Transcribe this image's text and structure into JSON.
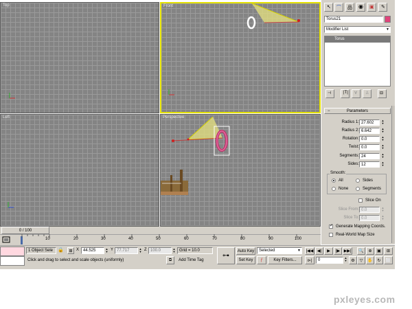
{
  "viewports": {
    "top": "Top",
    "front": "Front",
    "left": "Left",
    "perspective": "Perspective"
  },
  "command_panel": {
    "object_name": "Torus21",
    "modifier_list": "Modifier List",
    "stack_item": "Torus",
    "rollout_title": "Parameters",
    "params": [
      {
        "label": "Radius 1:",
        "value": "27.602"
      },
      {
        "label": "Radius 2:",
        "value": "6.642"
      },
      {
        "label": "Rotation:",
        "value": "0.0"
      },
      {
        "label": "Twist:",
        "value": "0.0"
      },
      {
        "label": "Segments:",
        "value": "24"
      },
      {
        "label": "Sides:",
        "value": "12"
      }
    ],
    "smooth_label": "Smooth:",
    "smooth_options": [
      "All",
      "Sides",
      "None",
      "Segments"
    ],
    "smooth_selected": "All",
    "slice_on": "Slice On",
    "slice_from_label": "Slice From:",
    "slice_from_value": "0.0",
    "slice_to_label": "Slice To:",
    "slice_to_value": "0.0",
    "gen_mapping": "Generate Mapping Coords.",
    "gen_mapping_checked": true,
    "real_world": "Real-World Map Size",
    "swatch_color": "#e0447a"
  },
  "timeline": {
    "slider": "0 / 100",
    "ticks": [
      "10",
      "20",
      "30",
      "40",
      "50",
      "60",
      "70",
      "80",
      "90",
      "100"
    ]
  },
  "status": {
    "selection": "1 Object Sele",
    "x_label": "X",
    "x_value": "44.525",
    "y_label": "Y",
    "y_value": "77.717",
    "z_label": "Z",
    "z_value": "100.0",
    "grid": "Grid = 10.0",
    "prompt": "Click and drag to select and scale objects (uniformly)",
    "add_time_tag": "Add Time Tag",
    "auto_key": "Auto Key",
    "set_key": "Set Key",
    "selected": "Selected",
    "key_filters": "Key Filters...",
    "frame": "0"
  },
  "watermark": "pxleyes.com"
}
